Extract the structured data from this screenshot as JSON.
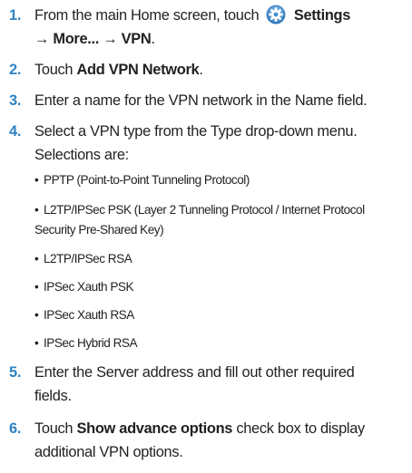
{
  "steps": [
    {
      "number": "1.",
      "line1_prefix": "From the main Home screen, touch",
      "settings_label": "Settings",
      "line2_path": "→ More... → VPN",
      "line2_end": "."
    },
    {
      "number": "2.",
      "prefix": "Touch ",
      "bold": "Add VPN Network",
      "suffix": "."
    },
    {
      "number": "3.",
      "text": "Enter a name for the VPN network in the Name field."
    },
    {
      "number": "4.",
      "line1": "Select a VPN type from the Type drop-down menu.",
      "line2": "Selections are:",
      "options": [
        "PPTP (Point-to-Point Tunneling Protocol)",
        "L2TP/IPSec PSK (Layer 2 Tunneling Protocol / Internet Protocol",
        "L2TP/IPSec RSA",
        "IPSec Xauth PSK",
        "IPSec Xauth RSA",
        "IPSec Hybrid RSA"
      ],
      "option2_cont": "Security Pre-Shared Key)"
    },
    {
      "number": "5.",
      "line1": "Enter the Server address and fill out other required",
      "line2": "fields."
    },
    {
      "number": "6.",
      "prefix": "Touch ",
      "bold": "Show advance options",
      "suffix": " check box to display",
      "line2": "additional VPN options."
    }
  ],
  "bullet": "•",
  "colors": {
    "step_number": "#2f84c5",
    "body_text": "#231f20",
    "icon_blue": "#3d8fd1"
  }
}
